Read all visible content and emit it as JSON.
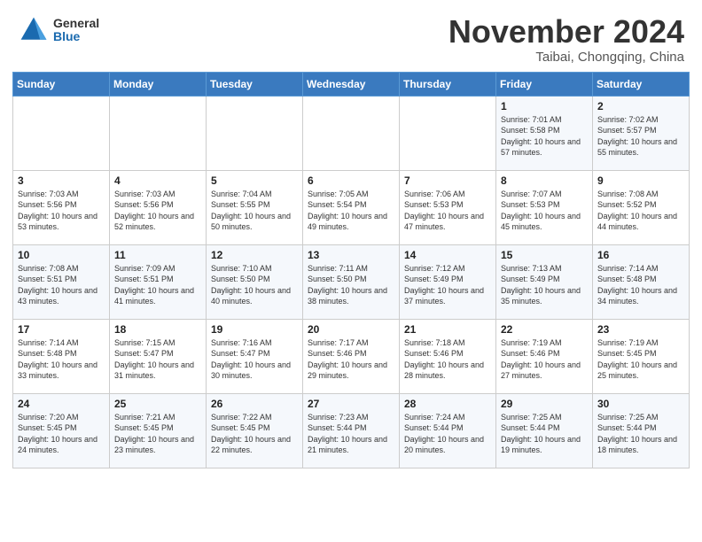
{
  "header": {
    "logo": {
      "general": "General",
      "blue": "Blue"
    },
    "title": "November 2024",
    "subtitle": "Taibai, Chongqing, China"
  },
  "weekdays": [
    "Sunday",
    "Monday",
    "Tuesday",
    "Wednesday",
    "Thursday",
    "Friday",
    "Saturday"
  ],
  "weeks": [
    [
      {
        "day": "",
        "info": ""
      },
      {
        "day": "",
        "info": ""
      },
      {
        "day": "",
        "info": ""
      },
      {
        "day": "",
        "info": ""
      },
      {
        "day": "",
        "info": ""
      },
      {
        "day": "1",
        "info": "Sunrise: 7:01 AM\nSunset: 5:58 PM\nDaylight: 10 hours and 57 minutes."
      },
      {
        "day": "2",
        "info": "Sunrise: 7:02 AM\nSunset: 5:57 PM\nDaylight: 10 hours and 55 minutes."
      }
    ],
    [
      {
        "day": "3",
        "info": "Sunrise: 7:03 AM\nSunset: 5:56 PM\nDaylight: 10 hours and 53 minutes."
      },
      {
        "day": "4",
        "info": "Sunrise: 7:03 AM\nSunset: 5:56 PM\nDaylight: 10 hours and 52 minutes."
      },
      {
        "day": "5",
        "info": "Sunrise: 7:04 AM\nSunset: 5:55 PM\nDaylight: 10 hours and 50 minutes."
      },
      {
        "day": "6",
        "info": "Sunrise: 7:05 AM\nSunset: 5:54 PM\nDaylight: 10 hours and 49 minutes."
      },
      {
        "day": "7",
        "info": "Sunrise: 7:06 AM\nSunset: 5:53 PM\nDaylight: 10 hours and 47 minutes."
      },
      {
        "day": "8",
        "info": "Sunrise: 7:07 AM\nSunset: 5:53 PM\nDaylight: 10 hours and 45 minutes."
      },
      {
        "day": "9",
        "info": "Sunrise: 7:08 AM\nSunset: 5:52 PM\nDaylight: 10 hours and 44 minutes."
      }
    ],
    [
      {
        "day": "10",
        "info": "Sunrise: 7:08 AM\nSunset: 5:51 PM\nDaylight: 10 hours and 43 minutes."
      },
      {
        "day": "11",
        "info": "Sunrise: 7:09 AM\nSunset: 5:51 PM\nDaylight: 10 hours and 41 minutes."
      },
      {
        "day": "12",
        "info": "Sunrise: 7:10 AM\nSunset: 5:50 PM\nDaylight: 10 hours and 40 minutes."
      },
      {
        "day": "13",
        "info": "Sunrise: 7:11 AM\nSunset: 5:50 PM\nDaylight: 10 hours and 38 minutes."
      },
      {
        "day": "14",
        "info": "Sunrise: 7:12 AM\nSunset: 5:49 PM\nDaylight: 10 hours and 37 minutes."
      },
      {
        "day": "15",
        "info": "Sunrise: 7:13 AM\nSunset: 5:49 PM\nDaylight: 10 hours and 35 minutes."
      },
      {
        "day": "16",
        "info": "Sunrise: 7:14 AM\nSunset: 5:48 PM\nDaylight: 10 hours and 34 minutes."
      }
    ],
    [
      {
        "day": "17",
        "info": "Sunrise: 7:14 AM\nSunset: 5:48 PM\nDaylight: 10 hours and 33 minutes."
      },
      {
        "day": "18",
        "info": "Sunrise: 7:15 AM\nSunset: 5:47 PM\nDaylight: 10 hours and 31 minutes."
      },
      {
        "day": "19",
        "info": "Sunrise: 7:16 AM\nSunset: 5:47 PM\nDaylight: 10 hours and 30 minutes."
      },
      {
        "day": "20",
        "info": "Sunrise: 7:17 AM\nSunset: 5:46 PM\nDaylight: 10 hours and 29 minutes."
      },
      {
        "day": "21",
        "info": "Sunrise: 7:18 AM\nSunset: 5:46 PM\nDaylight: 10 hours and 28 minutes."
      },
      {
        "day": "22",
        "info": "Sunrise: 7:19 AM\nSunset: 5:46 PM\nDaylight: 10 hours and 27 minutes."
      },
      {
        "day": "23",
        "info": "Sunrise: 7:19 AM\nSunset: 5:45 PM\nDaylight: 10 hours and 25 minutes."
      }
    ],
    [
      {
        "day": "24",
        "info": "Sunrise: 7:20 AM\nSunset: 5:45 PM\nDaylight: 10 hours and 24 minutes."
      },
      {
        "day": "25",
        "info": "Sunrise: 7:21 AM\nSunset: 5:45 PM\nDaylight: 10 hours and 23 minutes."
      },
      {
        "day": "26",
        "info": "Sunrise: 7:22 AM\nSunset: 5:45 PM\nDaylight: 10 hours and 22 minutes."
      },
      {
        "day": "27",
        "info": "Sunrise: 7:23 AM\nSunset: 5:44 PM\nDaylight: 10 hours and 21 minutes."
      },
      {
        "day": "28",
        "info": "Sunrise: 7:24 AM\nSunset: 5:44 PM\nDaylight: 10 hours and 20 minutes."
      },
      {
        "day": "29",
        "info": "Sunrise: 7:25 AM\nSunset: 5:44 PM\nDaylight: 10 hours and 19 minutes."
      },
      {
        "day": "30",
        "info": "Sunrise: 7:25 AM\nSunset: 5:44 PM\nDaylight: 10 hours and 18 minutes."
      }
    ]
  ]
}
